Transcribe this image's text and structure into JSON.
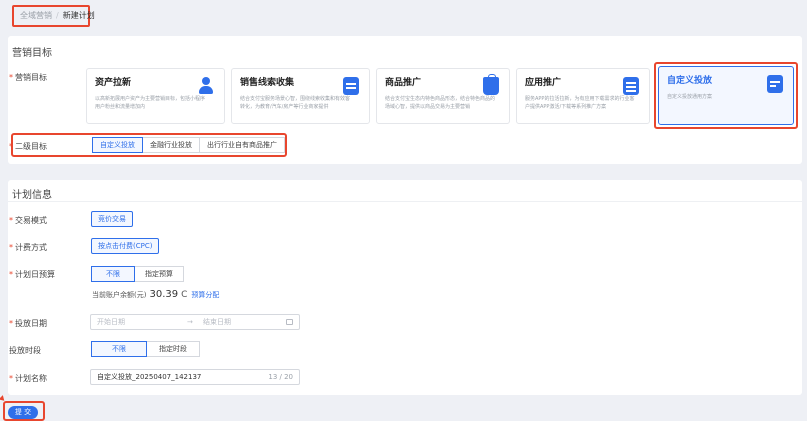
{
  "breadcrumb": {
    "parent": "全域营销",
    "separator": "/",
    "current": "新建计划"
  },
  "goal_section": {
    "title": "营销目标",
    "label": "营销目标",
    "cards": [
      {
        "title": "资产拉新",
        "desc": "以高新拓展用户资产为主要营销目标，包括小程序用户粉丝和流量增加内",
        "icon": "person-icon",
        "selected": false
      },
      {
        "title": "销售线索收集",
        "desc": "结合支付宝服务场景心智，围绕线索收集和有效客转化，为教育/汽车/房产等行业商家提供",
        "icon": "clue-icon",
        "selected": false
      },
      {
        "title": "商品推广",
        "desc": "结合支付宝生态内特色商品形态，结合特色商品的场域心智，提供以商品交易为主要营销",
        "icon": "shopping-bag-icon",
        "selected": false
      },
      {
        "title": "应用推广",
        "desc": "服务APP的拉活拉新，为有应用下载需求的行业客户提供APP激活/下载等系列推广方案",
        "icon": "app-icon",
        "selected": false
      },
      {
        "title": "自定义投放",
        "desc": "自定义投放通用方案",
        "icon": "custom-doc-icon",
        "selected": true
      }
    ],
    "sub_label": "二级目标",
    "sub_options": [
      "自定义投放",
      "金融行业投放",
      "出行行业自有商品推广"
    ],
    "sub_selected": 0
  },
  "plan_section": {
    "title": "计划信息",
    "trade_mode": {
      "label": "交易模式",
      "value": "竞价交易"
    },
    "billing": {
      "label": "计费方式",
      "value": "按点击付费(CPC)"
    },
    "daily_budget": {
      "label": "计划日预算",
      "options": [
        "不限",
        "指定预算"
      ],
      "selected": 0
    },
    "balance": {
      "prefix": "当前账户余额(元)",
      "value": "30.39",
      "refresh": "C",
      "link": "预算分配"
    },
    "date": {
      "label": "投放日期",
      "start_placeholder": "开始日期",
      "arrow": "→",
      "end_placeholder": "结束日期"
    },
    "time_slot": {
      "label": "投放时段",
      "options": [
        "不限",
        "指定时段"
      ],
      "selected": 0
    },
    "name": {
      "label": "计划名称",
      "value": "自定义投放_20250407_142137",
      "counter": "13 / 20"
    },
    "required_mark": "*"
  },
  "submit_label": "提 交",
  "colors": {
    "primary": "#2f6fea",
    "annotation": "#e8462e",
    "background": "#eef0f5"
  }
}
